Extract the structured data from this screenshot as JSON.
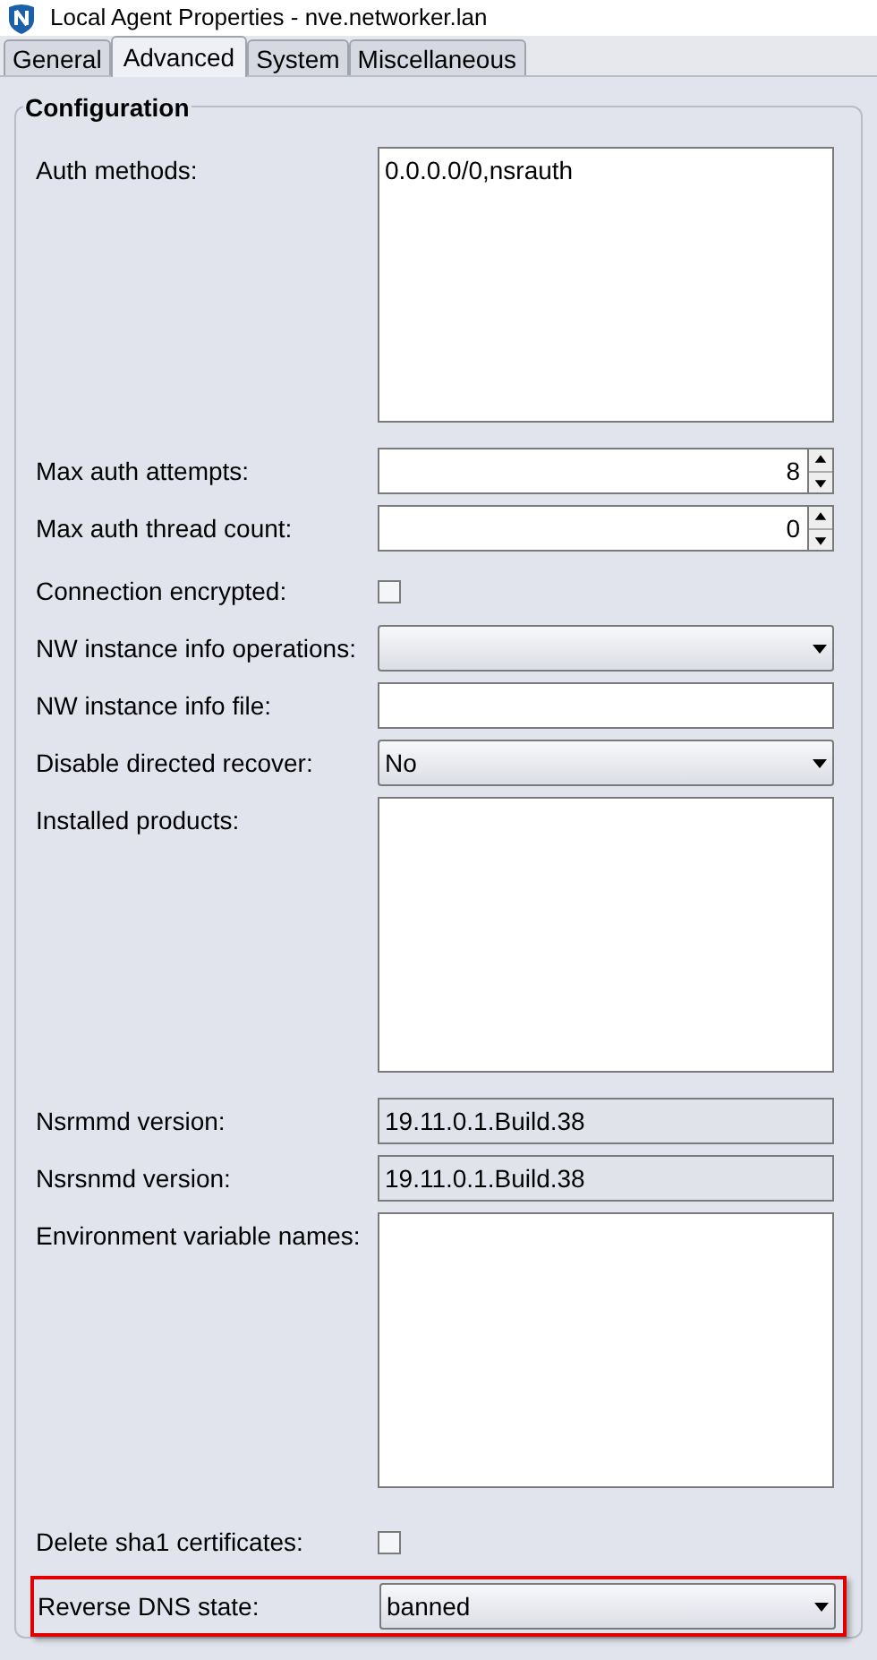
{
  "window": {
    "title": "Local Agent Properties - nve.networker.lan"
  },
  "tabs": [
    {
      "label": "General",
      "selected": false
    },
    {
      "label": "Advanced",
      "selected": true
    },
    {
      "label": "System",
      "selected": false
    },
    {
      "label": "Miscellaneous",
      "selected": false
    }
  ],
  "group": {
    "title": "Configuration"
  },
  "fields": [
    {
      "kind": "textarea",
      "label": "Auth methods:",
      "value": "0.0.0.0/0,nsrauth",
      "highlighted": false
    },
    {
      "kind": "spinner",
      "label": "Max auth attempts:",
      "value": "8",
      "highlighted": false
    },
    {
      "kind": "spinner",
      "label": "Max auth thread count:",
      "value": "0",
      "highlighted": false
    },
    {
      "kind": "checkbox",
      "label": "Connection encrypted:",
      "checked": false,
      "highlighted": false
    },
    {
      "kind": "dropdown",
      "label": "NW instance info operations:",
      "highlighted": false
    },
    {
      "kind": "text",
      "label": "NW instance info file:",
      "highlighted": false
    },
    {
      "kind": "dropdown",
      "label": "Disable directed recover:",
      "value": "No",
      "highlighted": false
    },
    {
      "kind": "textarea",
      "label": "Installed products:",
      "highlighted": false
    },
    {
      "kind": "readonly",
      "label": "Nsrmmd version:",
      "value": "19.11.0.1.Build.38",
      "highlighted": false
    },
    {
      "kind": "readonly",
      "label": "Nsrsnmd version:",
      "value": "19.11.0.1.Build.38",
      "highlighted": false
    },
    {
      "kind": "textarea",
      "label": "Environment variable names:",
      "highlighted": false
    },
    {
      "kind": "checkbox",
      "label": "Delete sha1 certificates:",
      "checked": false,
      "highlighted": false
    },
    {
      "kind": "dropdown",
      "label": "Reverse DNS state:",
      "value": "banned",
      "highlighted": true
    }
  ]
}
